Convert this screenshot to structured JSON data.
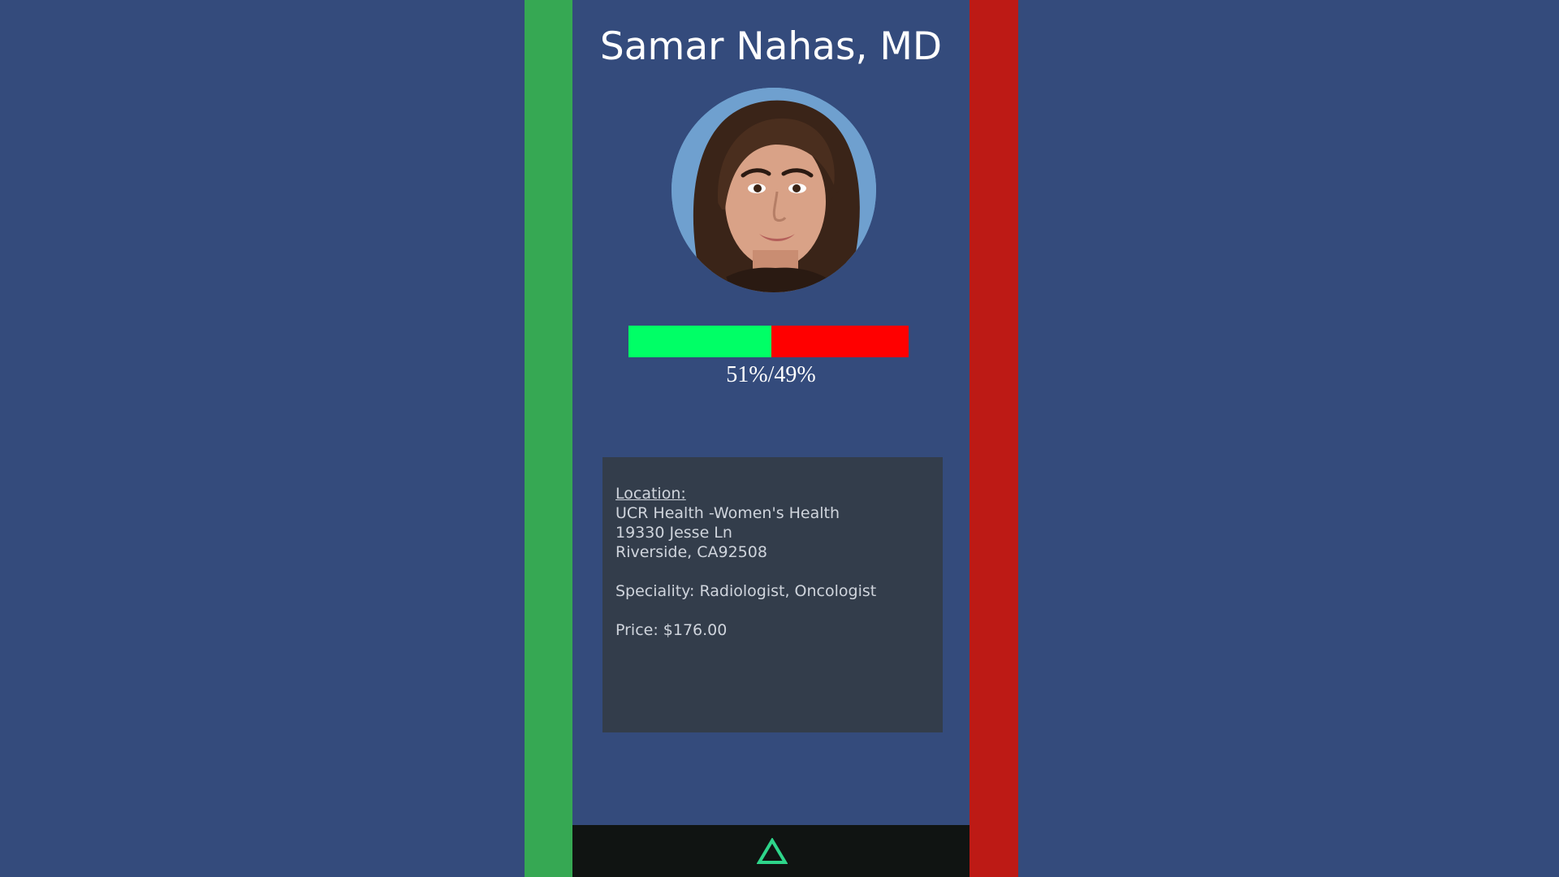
{
  "doctor": {
    "name": "Samar Nahas, MD",
    "photo_alt": "Samar Nahas, MD"
  },
  "rating": {
    "approve_fraction": 0.51,
    "label": "51%/49%",
    "approve_color": "#00ff66",
    "reject_color": "#ff0000"
  },
  "info": {
    "location_heading": "Location:",
    "location_name": "UCR Health -Women's Health",
    "street": "19330 Jesse Ln",
    "city": "Riverside, CA92508",
    "specialty": "Speciality: Radiologist, Oncologist",
    "price": "Price: $176.00"
  },
  "swipe": {
    "left_color": "#36a853",
    "right_color": "#bd1a15"
  },
  "nav": {
    "home_icon": "triangle-up-icon",
    "icon_color": "#2ed58a"
  }
}
